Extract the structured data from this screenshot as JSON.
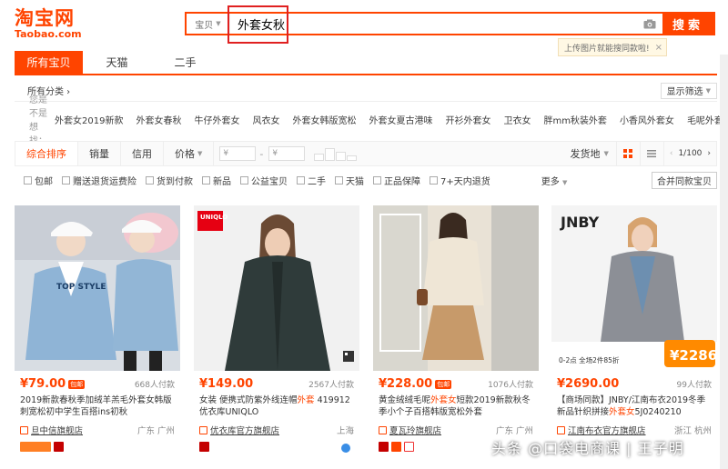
{
  "logo": {
    "cn": "淘宝网",
    "en": "Taobao.com"
  },
  "search": {
    "category": "宝贝",
    "query": "外套女秋",
    "button": "搜索"
  },
  "tip": {
    "text": "上传图片就能搜同款啦!"
  },
  "tabs": [
    "所有宝贝",
    "天猫",
    "二手"
  ],
  "category_row": {
    "label": "所有分类 ›",
    "filter": "显示筛选"
  },
  "did_you_mean": {
    "label": "您是不是想找：",
    "keywords": [
      "外套女2019新款",
      "外套女春秋",
      "牛仔外套女",
      "风衣女",
      "外套女韩版宽松",
      "外套女夏古港味",
      "开衫外套女",
      "卫衣女",
      "胖mm秋装外套",
      "小香风外套女",
      "毛呢外套女"
    ]
  },
  "sortbar": {
    "sorts": [
      "综合排序",
      "销量",
      "信用",
      "价格"
    ],
    "price_from": "¥",
    "price_to": "¥",
    "ship_from": "发货地",
    "page": "1/100"
  },
  "checks": [
    "包邮",
    "赠送退货运费险",
    "货到付款",
    "新品",
    "公益宝贝",
    "二手",
    "天猫",
    "正品保障",
    "7+天内退货"
  ],
  "more": "更多",
  "merge": "合并同款宝贝",
  "products": [
    {
      "price": "¥79.00",
      "tag": "包邮",
      "sold": "668人付款",
      "title_a": "2019新款春秋季加绒羊羔毛外套女韩版刺",
      "title_b": "宽松初中学生百搭ins初秋",
      "shop": "旦中信旗舰店",
      "loc": "广东 广州"
    },
    {
      "price": "¥149.00",
      "tag": "",
      "sold": "2567人付款",
      "title_pre": "女装 便携式防紫外线连帽",
      "title_hl": "外套",
      "title_post": " 419912 优衣库UNIQLO",
      "shop": "优衣库官方旗舰店",
      "loc": "上海"
    },
    {
      "price": "¥228.00",
      "tag": "包邮",
      "sold": "1076人付款",
      "title_pre": "黄金绒绒毛呢",
      "title_hl": "外套女",
      "title_post": "短款2019新款秋冬季小个子百搭韩版宽松外套",
      "shop": "夏瓦玲旗舰店",
      "loc": "广东 广州"
    },
    {
      "price": "¥2690.00",
      "tag": "",
      "sold": "99人付款",
      "title_pre": "【商场同款】JNBY/江南布衣2019冬季新品针织拼接",
      "title_hl": "外套女",
      "title_post": "5J0240210",
      "shop": "江南布衣官方旗舰店",
      "loc": "浙江 杭州",
      "img_brand": "JNBY",
      "img_promo": "0-2点 全场2件85折",
      "img_price": "¥2286"
    }
  ],
  "img_brand_1": "UNIQLO",
  "img_text_0": "TOP STYLE",
  "watermark": "头条 @口袋电商课 | 王子明",
  "colors": {
    "accent": "#ff4400",
    "redbox": "#e02020"
  }
}
